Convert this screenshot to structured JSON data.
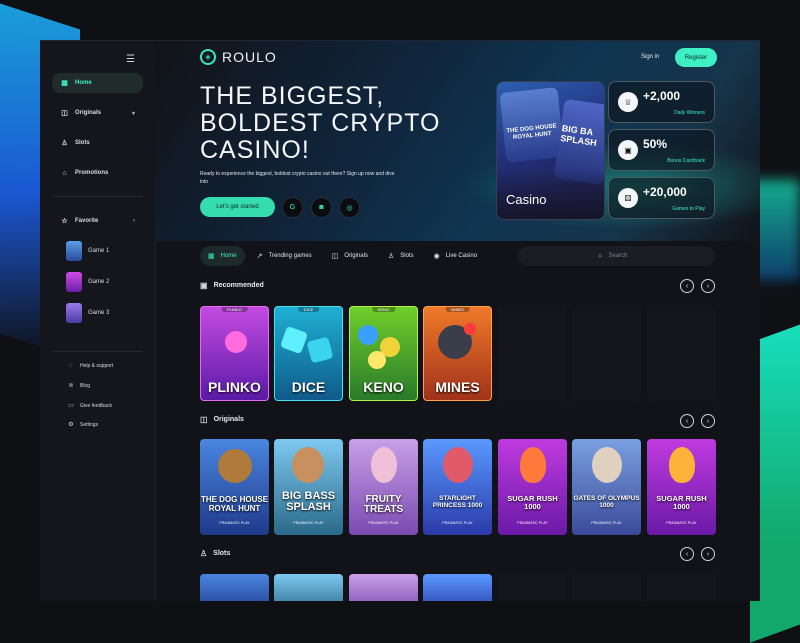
{
  "brand": {
    "name": "ROULO",
    "accent": "#3ef0c3"
  },
  "header": {
    "signin": "Sign in",
    "register": "Register"
  },
  "sidebar": {
    "items": [
      {
        "label": "Home",
        "icon": "grid-icon",
        "active": true
      },
      {
        "label": "Originals",
        "icon": "gamepad-icon"
      },
      {
        "label": "Slots",
        "icon": "joystick-icon"
      },
      {
        "label": "Promotions",
        "icon": "gift-icon"
      }
    ],
    "favorite": "Favorite",
    "games": [
      "Game 1",
      "Game 2",
      "Game 3"
    ],
    "links": [
      "Help & support",
      "Blog",
      "Give feedback",
      "Settings"
    ]
  },
  "hero": {
    "headline": "THE BIGGEST, BOLDEST CRYPTO CASINO!",
    "subtext": "Ready to experience the biggest, boldest crypto casino out there? Sign up now and dive into",
    "cta": "Let's get started",
    "casino_card": {
      "label": "Casino",
      "art1": "THE DOG HOUSE ROYAL HUNT",
      "art2": "BIG BA SPLASH"
    },
    "stats": [
      {
        "value": "+2,000",
        "label": "Daily Winners"
      },
      {
        "value": "50%",
        "label": "Bonus Cashback"
      },
      {
        "value": "+20,000",
        "label": "Games to Play"
      }
    ]
  },
  "tabs": [
    "Home",
    "Trending games",
    "Originals",
    "Slots",
    "Live Casino"
  ],
  "search": {
    "placeholder": "Search"
  },
  "sections": {
    "recommended": "Recommended",
    "originals": "Originals",
    "slots": "Slots"
  },
  "recommended": [
    {
      "tag": "PLINKO",
      "label": "PLINKO"
    },
    {
      "tag": "DICE",
      "label": "DICE"
    },
    {
      "tag": "KENO",
      "label": "KENO"
    },
    {
      "tag": "MINES",
      "label": "MINES"
    }
  ],
  "originals": [
    {
      "name": "THE DOG HOUSE ROYAL HUNT",
      "provider": "PRAGMATIC PLAY"
    },
    {
      "name": "BIG BASS SPLASH",
      "provider": "PRAGMATIC PLAY"
    },
    {
      "name": "FRUITY TREATS",
      "provider": "PRAGMATIC PLAY"
    },
    {
      "name": "STARLIGHT PRINCESS 1000",
      "provider": "PRAGMATIC PLAY"
    },
    {
      "name": "SUGAR RUSH 1000",
      "provider": "PRAGMATIC PLAY"
    },
    {
      "name": "GATES OF OLYMPUS 1000",
      "provider": "PRAGMATIC PLAY"
    },
    {
      "name": "SUGAR RUSH 1000",
      "provider": "PRAGMATIC PLAY"
    }
  ]
}
